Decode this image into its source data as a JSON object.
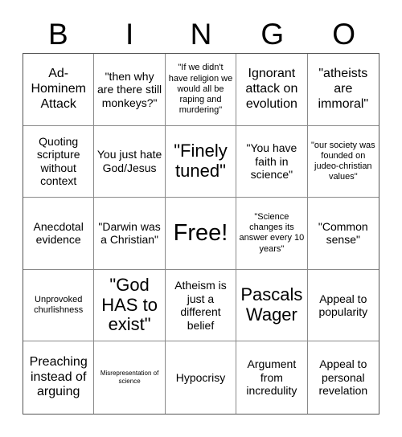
{
  "header": {
    "letters": [
      "B",
      "I",
      "N",
      "G",
      "O"
    ]
  },
  "grid": {
    "rows": 5,
    "columns": 5,
    "cells": [
      {
        "text": "Ad-Hominem Attack",
        "size": "lg"
      },
      {
        "text": "\"then why are there still monkeys?\"",
        "size": "md"
      },
      {
        "text": "\"If we didn't have religion we would all be raping and murdering\"",
        "size": "sm"
      },
      {
        "text": "Ignorant attack on evolution",
        "size": "lg"
      },
      {
        "text": "\"atheists are immoral\"",
        "size": "lg"
      },
      {
        "text": "Quoting scripture without context",
        "size": "md"
      },
      {
        "text": "You just hate God/Jesus",
        "size": "md"
      },
      {
        "text": "\"Finely tuned\"",
        "size": "xl"
      },
      {
        "text": "\"You have faith in science\"",
        "size": "md"
      },
      {
        "text": "\"our society was founded on judeo-christian values\"",
        "size": "sm"
      },
      {
        "text": "Anecdotal evidence",
        "size": "md"
      },
      {
        "text": "\"Darwin was a Christian\"",
        "size": "md"
      },
      {
        "text": "Free!",
        "size": "xxl"
      },
      {
        "text": "\"Science changes its answer every 10 years\"",
        "size": "sm"
      },
      {
        "text": "\"Common sense\"",
        "size": "md"
      },
      {
        "text": "Unprovoked churlishness",
        "size": "sm"
      },
      {
        "text": "\"God HAS to exist\"",
        "size": "xl"
      },
      {
        "text": "Atheism is just a different belief",
        "size": "md"
      },
      {
        "text": "Pascals Wager",
        "size": "xl"
      },
      {
        "text": "Appeal to popularity",
        "size": "md"
      },
      {
        "text": "Preaching instead of arguing",
        "size": "lg"
      },
      {
        "text": "Misrepresentation of science",
        "size": "xs"
      },
      {
        "text": "Hypocrisy",
        "size": "md"
      },
      {
        "text": "Argument from incredulity",
        "size": "md"
      },
      {
        "text": "Appeal to personal revelation",
        "size": "md"
      }
    ]
  },
  "colors": {
    "background": "#ffffff",
    "text": "#000000",
    "grid_line": "#8a8a8a",
    "grid_border": "#555555"
  }
}
